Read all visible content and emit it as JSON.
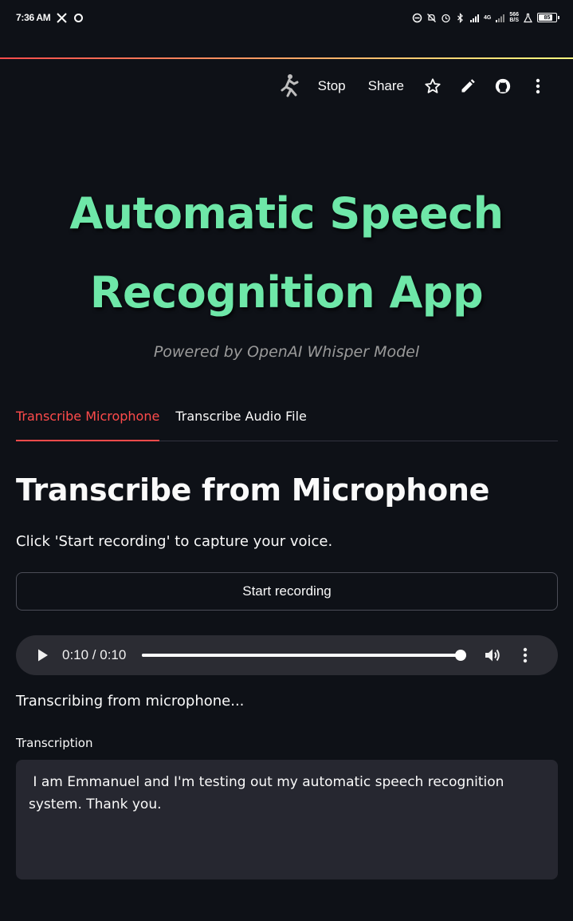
{
  "status_bar": {
    "time": "7:36 AM",
    "net_speed_top": "566",
    "net_speed_bottom": "B/S",
    "network_type_top": "4G",
    "battery_level": "85"
  },
  "toolbar": {
    "stop_label": "Stop",
    "share_label": "Share"
  },
  "header": {
    "title": "Automatic Speech Recognition App",
    "subtitle": "Powered by OpenAI Whisper Model"
  },
  "tabs": [
    {
      "label": "Transcribe Microphone",
      "active": true
    },
    {
      "label": "Transcribe Audio File",
      "active": false
    }
  ],
  "main": {
    "heading": "Transcribe from Microphone",
    "instruction": "Click 'Start recording' to capture your voice.",
    "record_button_label": "Start recording",
    "player": {
      "time_display": "0:10 / 0:10",
      "progress": 1.0
    },
    "status_message": "Transcribing from microphone...",
    "transcription_label": "Transcription",
    "transcription_text": " I am Emmanuel and I'm testing out my automatic speech recognition system. Thank you."
  },
  "colors": {
    "accent": "#ff4b4b",
    "title": "#6ee7a8",
    "background": "#0e1117",
    "input_bg": "#262730"
  }
}
